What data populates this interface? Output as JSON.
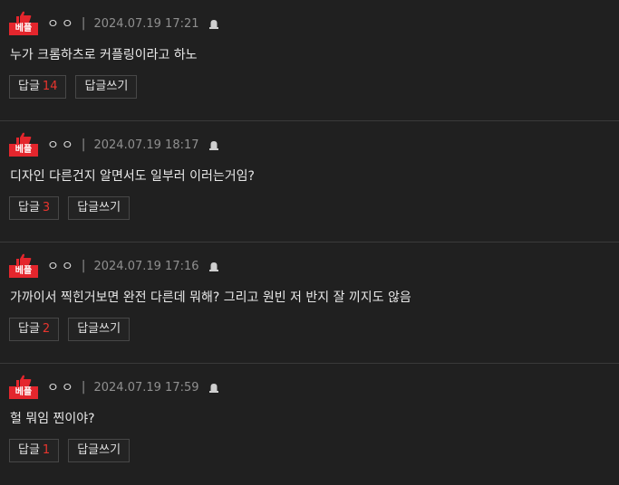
{
  "badge_label": "베플",
  "reply_label": "답글",
  "write_reply_label": "답글쓰기",
  "comments": [
    {
      "nickname": "ㅇㅇ",
      "separator": "|",
      "date": "2024.07.19 17:21",
      "text": "누가 크롬하츠로 커플링이라고 하노",
      "reply_count": "14"
    },
    {
      "nickname": "ㅇㅇ",
      "separator": "|",
      "date": "2024.07.19 18:17",
      "text": "디자인 다른건지 알면서도 일부러 이러는거임?",
      "reply_count": "3"
    },
    {
      "nickname": "ㅇㅇ",
      "separator": "|",
      "date": "2024.07.19 17:16",
      "text": "가까이서 찍힌거보면 완전 다른데 뭐해? 그리고 원빈 저 반지 잘 끼지도 않음",
      "reply_count": "2"
    },
    {
      "nickname": "ㅇㅇ",
      "separator": "|",
      "date": "2024.07.19 17:59",
      "text": "헐 뭐임 찐이야?",
      "reply_count": "1"
    }
  ]
}
